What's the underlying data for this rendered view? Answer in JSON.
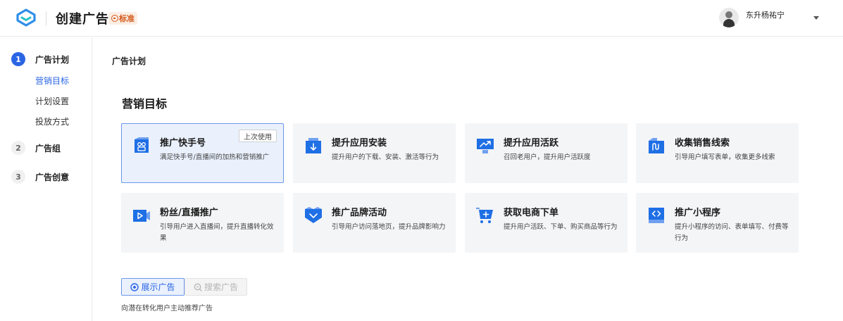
{
  "header": {
    "title": "创建广告",
    "edition_badge": "标准",
    "logo_icon": "brand-logo-icon",
    "user_name": "东升杨祐宁"
  },
  "sidebar": {
    "steps": [
      {
        "num": "1",
        "label": "广告计划",
        "active": true,
        "sub_items": [
          {
            "label": "营销目标",
            "active": true
          },
          {
            "label": "计划设置",
            "active": false
          },
          {
            "label": "投放方式",
            "active": false
          }
        ]
      },
      {
        "num": "2",
        "label": "广告组",
        "active": false
      },
      {
        "num": "3",
        "label": "广告创意",
        "active": false
      }
    ]
  },
  "main": {
    "breadcrumb": "广告计划",
    "section_title": "营销目标",
    "objectives": [
      {
        "title": "推广快手号",
        "desc": "满足快手号/直播间的加热和营销推广",
        "badge": "上次使用",
        "selected": true,
        "icon": "kuaishou-account-icon"
      },
      {
        "title": "提升应用安装",
        "desc": "提升用户的下载、安装、激活等行为",
        "icon": "app-install-icon"
      },
      {
        "title": "提升应用活跃",
        "desc": "召回老用户，提升用户活跃度",
        "icon": "app-active-icon"
      },
      {
        "title": "收集销售线索",
        "desc": "引导用户填写表单，收集更多线索",
        "icon": "sales-leads-icon"
      },
      {
        "title": "粉丝/直播推广",
        "desc": "引导用户进入直播间，提升直播转化效果",
        "icon": "live-video-icon"
      },
      {
        "title": "推广品牌活动",
        "desc": "引导用户访问落地页，提升品牌影响力",
        "icon": "brand-activity-icon"
      },
      {
        "title": "获取电商下单",
        "desc": "提升用户活跃、下单、购买商品等行为",
        "icon": "shopping-cart-icon"
      },
      {
        "title": "推广小程序",
        "desc": "提升小程序的访问、表单填写、付费等行为",
        "icon": "mini-program-icon"
      }
    ],
    "ad_type_tabs": [
      {
        "label": "展示广告",
        "active": true,
        "icon": "display-ad-icon"
      },
      {
        "label": "搜索广告",
        "active": false,
        "icon": "search-ad-icon"
      }
    ],
    "ad_type_hint": "向潜在转化用户主动推荐广告"
  },
  "colors": {
    "accent": "#2b65e3",
    "selected_bg": "#eaf1fd",
    "card_bg": "#f4f5f7",
    "icon_blue": "#1f6fe5",
    "edition_orange": "#d35a1b"
  }
}
